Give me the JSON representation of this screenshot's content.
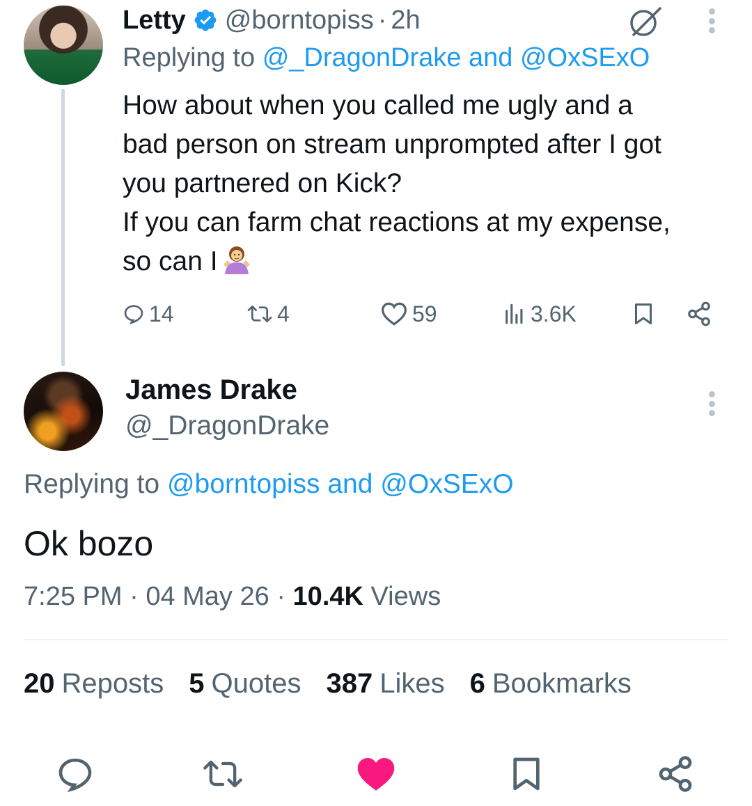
{
  "reply": {
    "name": "Letty",
    "handle": "@borntopiss",
    "dot": "·",
    "time": "2h",
    "replying_prefix": "Replying to",
    "replying_user1": "@_DragonDrake",
    "replying_and": "and",
    "replying_user2": "@OxSExO",
    "text_lines": [
      "How about when you called me ugly and a",
      "bad person on stream unprompted after I got",
      "you partnered on Kick?",
      "If you can farm chat reactions at my expense,",
      "so can I"
    ],
    "actions": {
      "replies": "14",
      "reposts": "4",
      "likes": "59",
      "views": "3.6K"
    }
  },
  "tweet": {
    "name": "James Drake",
    "handle": "@_DragonDrake",
    "replying_prefix": "Replying to",
    "replying_user1": "@borntopiss",
    "replying_and": "and",
    "replying_user2": "@OxSExO",
    "text": "Ok bozo",
    "time": "7:25 PM",
    "dot": "·",
    "date": "04 May 26",
    "views_count": "10.4K",
    "views_label": "Views",
    "stats": {
      "reposts_count": "20",
      "reposts_label": "Reposts",
      "quotes_count": "5",
      "quotes_label": "Quotes",
      "likes_count": "387",
      "likes_label": "Likes",
      "bookmarks_count": "6",
      "bookmarks_label": "Bookmarks"
    }
  },
  "colors": {
    "link": "#1d9bf0",
    "muted": "#536471",
    "text": "#0f1419",
    "like_active": "#f91880",
    "divider": "#eff3f4"
  },
  "icons": {
    "verified": "verified-badge-icon",
    "grok": "grok-icon",
    "more": "more-vertical-icon",
    "reply": "reply-icon",
    "repost": "repost-icon",
    "like": "heart-icon",
    "views": "views-icon",
    "bookmark": "bookmark-icon",
    "share": "share-icon",
    "emoji": "shrugging-woman-emoji"
  }
}
